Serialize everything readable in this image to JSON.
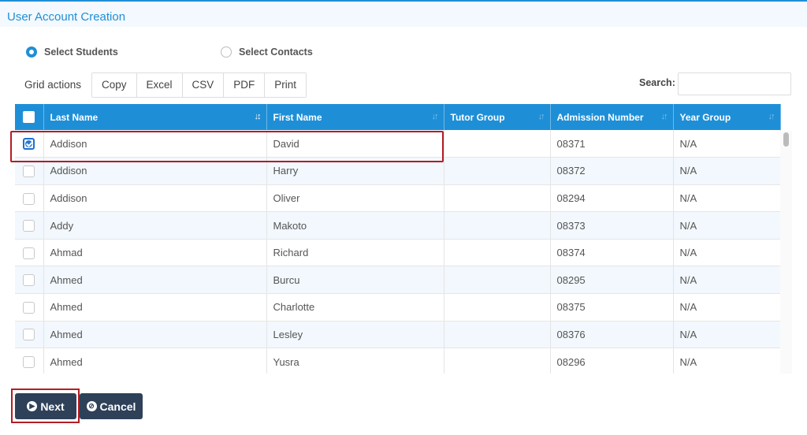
{
  "header": {
    "title": "User Account Creation"
  },
  "selection": {
    "options": [
      {
        "label": "Select Students",
        "selected": true
      },
      {
        "label": "Select Contacts",
        "selected": false
      }
    ]
  },
  "toolbar": {
    "grid_actions_label": "Grid actions",
    "buttons": [
      "Copy",
      "Excel",
      "CSV",
      "PDF",
      "Print"
    ],
    "search_label": "Search:",
    "search_value": ""
  },
  "table": {
    "columns": [
      "Last Name",
      "First Name",
      "Tutor Group",
      "Admission Number",
      "Year Group"
    ],
    "rows": [
      {
        "checked": true,
        "last_name": "Addison",
        "first_name": "David",
        "tutor_group": "",
        "admission_number": "08371",
        "year_group": "N/A"
      },
      {
        "checked": false,
        "last_name": "Addison",
        "first_name": "Harry",
        "tutor_group": "",
        "admission_number": "08372",
        "year_group": "N/A"
      },
      {
        "checked": false,
        "last_name": "Addison",
        "first_name": "Oliver",
        "tutor_group": "",
        "admission_number": "08294",
        "year_group": "N/A"
      },
      {
        "checked": false,
        "last_name": "Addy",
        "first_name": "Makoto",
        "tutor_group": "",
        "admission_number": "08373",
        "year_group": "N/A"
      },
      {
        "checked": false,
        "last_name": "Ahmad",
        "first_name": "Richard",
        "tutor_group": "",
        "admission_number": "08374",
        "year_group": "N/A"
      },
      {
        "checked": false,
        "last_name": "Ahmed",
        "first_name": "Burcu",
        "tutor_group": "",
        "admission_number": "08295",
        "year_group": "N/A"
      },
      {
        "checked": false,
        "last_name": "Ahmed",
        "first_name": "Charlotte",
        "tutor_group": "",
        "admission_number": "08375",
        "year_group": "N/A"
      },
      {
        "checked": false,
        "last_name": "Ahmed",
        "first_name": "Lesley",
        "tutor_group": "",
        "admission_number": "08376",
        "year_group": "N/A"
      },
      {
        "checked": false,
        "last_name": "Ahmed",
        "first_name": "Yusra",
        "tutor_group": "",
        "admission_number": "08296",
        "year_group": "N/A"
      }
    ]
  },
  "footer": {
    "next_label": "Next",
    "cancel_label": "Cancel"
  },
  "colors": {
    "accent": "#1e8fd7",
    "button_dark": "#2e4159",
    "highlight": "#b41d24"
  }
}
